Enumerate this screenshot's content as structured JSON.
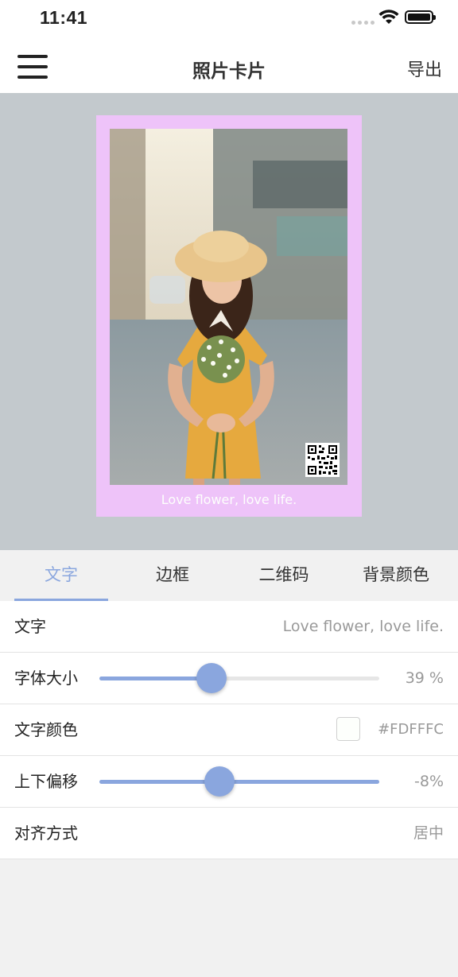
{
  "status_bar": {
    "time": "11:41"
  },
  "nav": {
    "title": "照片卡片",
    "export_label": "导出"
  },
  "card": {
    "frame_color": "#EEC3F9",
    "caption": "Love flower, love life.",
    "caption_color": "#FDFFFC"
  },
  "tabs": [
    {
      "label": "文字",
      "active": true
    },
    {
      "label": "边框",
      "active": false
    },
    {
      "label": "二维码",
      "active": false
    },
    {
      "label": "背景颜色",
      "active": false
    }
  ],
  "settings": {
    "text": {
      "label": "文字",
      "value": "Love flower, love life."
    },
    "font_size": {
      "label": "字体大小",
      "value_text": "39 %",
      "value_fraction": 0.4
    },
    "text_color": {
      "label": "文字颜色",
      "value": "#FDFFFC"
    },
    "vertical_offset": {
      "label": "上下偏移",
      "value_text": "-8%",
      "value_fraction": 0.43
    },
    "alignment": {
      "label": "对齐方式",
      "value": "居中"
    }
  },
  "accent_color": "#8AA6DE"
}
